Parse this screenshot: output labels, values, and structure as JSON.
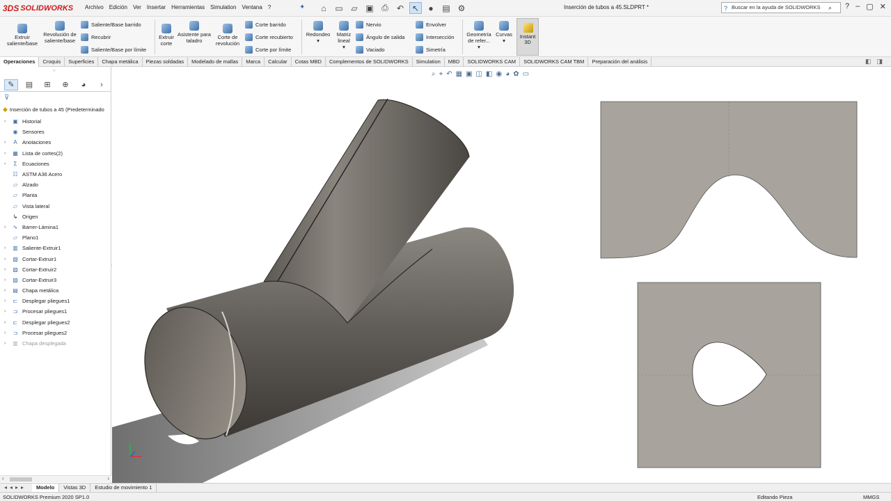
{
  "app": {
    "logo_prefix": "3DS",
    "logo_text": "SOLIDWORKS",
    "document_title": "Inserción de tubos a 45.SLDPRT *"
  },
  "menu": [
    "Archivo",
    "Edición",
    "Ver",
    "Insertar",
    "Herramientas",
    "Simulation",
    "Ventana",
    "?"
  ],
  "search": {
    "text": "Buscar en la ayuda de SOLIDWORKS"
  },
  "ribbon": {
    "extruir": "Extruir saliente/base",
    "revolucion": "Revolución de saliente/base",
    "saliente_barrido": "Saliente/Base barrido",
    "recubrir": "Recubrir",
    "saliente_limite": "Saliente/Base por límite",
    "extruir_corte": "Extruir corte",
    "asistente": "Asistente para taladro",
    "corte_revolucion": "Corte de revolución",
    "corte_barrido": "Corte barrido",
    "corte_recubierto": "Corte recubierto",
    "corte_limite": "Corte por límite",
    "redondeo": "Redondeo",
    "matriz": "Matriz lineal",
    "nervio": "Nervio",
    "angulo": "Ángulo de salida",
    "vaciado": "Vaciado",
    "envolver": "Envolver",
    "interseccion": "Intersección",
    "simetria": "Simetría",
    "geometria": "Geometría de refer...",
    "curvas": "Curvas",
    "instant3d": "Instant 3D"
  },
  "command_tabs": [
    "Operaciones",
    "Croquis",
    "Superficies",
    "Chapa metálica",
    "Piezas soldadas",
    "Modelado de mallas",
    "Marca",
    "Calcular",
    "Cotas MBD",
    "Complementos de SOLIDWORKS",
    "Simulation",
    "MBD",
    "SOLIDWORKS CAM",
    "SOLIDWORKS CAM TBM",
    "Preparación del análisis"
  ],
  "tree": {
    "root": "Inserción de tubos a 45  (Predeterminado",
    "items": [
      {
        "label": "Historial",
        "expand": "›"
      },
      {
        "label": "Sensores",
        "expand": ""
      },
      {
        "label": "Anotaciones",
        "expand": "›"
      },
      {
        "label": "Lista de cortes(2)",
        "expand": "›"
      },
      {
        "label": "Ecuaciones",
        "expand": "›"
      },
      {
        "label": "ASTM A36 Acero",
        "expand": ""
      },
      {
        "label": "Alzado",
        "expand": ""
      },
      {
        "label": "Planta",
        "expand": ""
      },
      {
        "label": "Vista lateral",
        "expand": ""
      },
      {
        "label": "Origen",
        "expand": ""
      },
      {
        "label": "Barrer-Lámina1",
        "expand": "›"
      },
      {
        "label": "Plano1",
        "expand": ""
      },
      {
        "label": "Saliente-Extruir1",
        "expand": "›"
      },
      {
        "label": "Cortar-Extruir1",
        "expand": "›"
      },
      {
        "label": "Cortar-Extruir2",
        "expand": "›"
      },
      {
        "label": "Cortar-Extruir3",
        "expand": "›"
      },
      {
        "label": "Chapa metálica",
        "expand": "›"
      },
      {
        "label": "Desplegar pliegues1",
        "expand": "›"
      },
      {
        "label": "Procesar pliegues1",
        "expand": "›"
      },
      {
        "label": "Desplegar pliegues2",
        "expand": "›"
      },
      {
        "label": "Procesar pliegues2",
        "expand": "›"
      },
      {
        "label": "Chapa desplegada",
        "expand": "›"
      }
    ]
  },
  "bottom_tabs": [
    "Modelo",
    "Vistas 3D",
    "Estudio de movimiento 1"
  ],
  "status": {
    "left": "SOLIDWORKS Premium 2020 SP1.0",
    "mid": "Editando Pieza",
    "right": "MMGS"
  },
  "colors": {
    "metal": "#6f6b66",
    "sheet": "#a8a39c",
    "shadow": "#8a8a8a"
  }
}
